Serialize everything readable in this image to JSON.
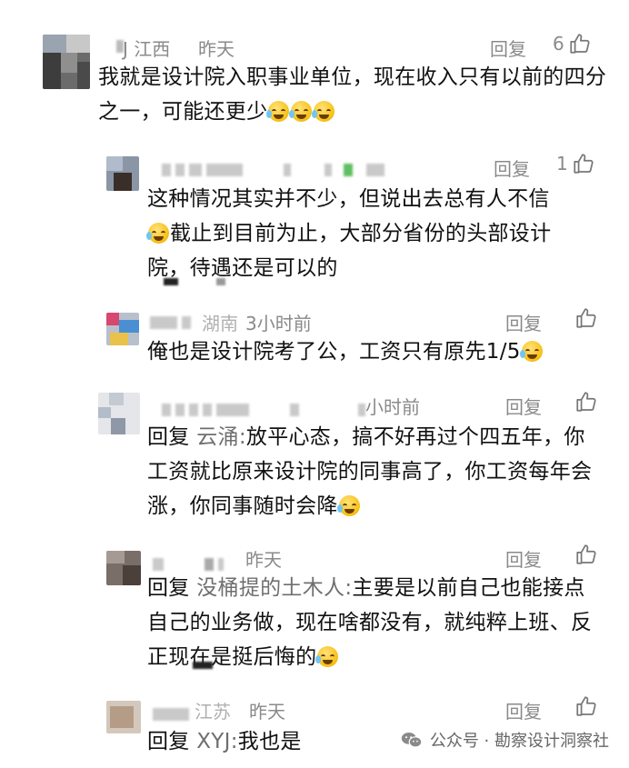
{
  "comments": [
    {
      "name_visible": "J 江西",
      "time": "昨天",
      "reply_label": "回复",
      "likes": "6",
      "text": "我就是设计院入职事业单位，现在收入只有以前的四分之一，可能还更少",
      "emoji_count": 3
    },
    {
      "time": "",
      "reply_label": "回复",
      "likes": "1",
      "text_a": "这种情况其实并不少，但说出去总有人不信",
      "text_b": "截止到目前为止，大部分省份的头部设计院，待遇还是可以的"
    },
    {
      "name_visible": "湖南",
      "time": "3小时前",
      "reply_label": "回复",
      "likes": "",
      "text": "俺也是设计院考了公，工资只有原先1/5"
    },
    {
      "time": "小时前",
      "reply_label": "回复",
      "likes": "",
      "reply_prefix": "回复",
      "reply_target": "云涌:",
      "text": "放平心态，搞不好再过个四五年，你工资就比原来设计院的同事高了，你工资每年会涨，你同事随时会降"
    },
    {
      "time": "昨天",
      "reply_label": "回复",
      "likes": "",
      "reply_prefix": "回复",
      "reply_target": "没桶提的土木人:",
      "text": "主要是以前自己也能接点自己的业务做，现在啥都没有，就纯粹上班、反正现在是挺后悔的"
    },
    {
      "name_visible": "江苏",
      "time": "昨天",
      "reply_label": "回复",
      "likes": "",
      "reply_prefix": "回复",
      "reply_target": "XYJ:",
      "text": "我也是"
    }
  ],
  "footer": {
    "source": "公众号 · 勘察设计洞察社"
  },
  "colors": {
    "meta": "#8a8a8a",
    "text": "#111111",
    "reply_target": "#6f6f6f",
    "background": "#ffffff"
  },
  "icons": [
    "thumbs-up-icon",
    "wechat-icon",
    "cry-laugh-emoji"
  ]
}
